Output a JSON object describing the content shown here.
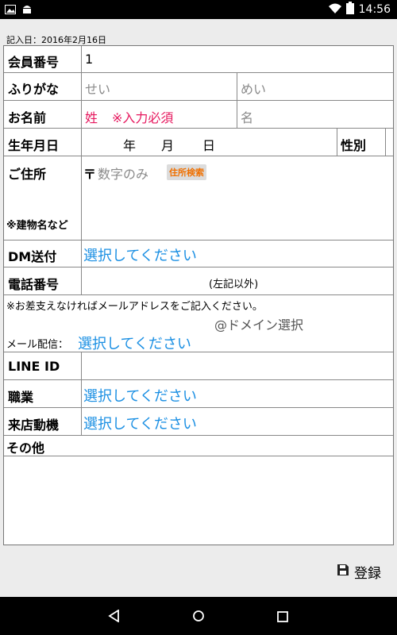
{
  "status_bar": {
    "time": "14:56",
    "battery_level": "4"
  },
  "header": {
    "date_label": "記入日：",
    "date_value": "2016年2月16日"
  },
  "rows": {
    "member": {
      "label": "会員番号",
      "value": "1"
    },
    "furigana": {
      "label": "ふりがな",
      "sei_placeholder": "せい",
      "mei_placeholder": "めい"
    },
    "name": {
      "label": "お名前",
      "sei": "姓",
      "required": "※入力必須",
      "mei_placeholder": "名"
    },
    "birth": {
      "label": "生年月日",
      "year": "年",
      "month": "月",
      "day": "日",
      "gender_label": "性別"
    },
    "address": {
      "label": "ご住所",
      "postal_mark": "〒",
      "postal_placeholder": "数字のみ",
      "search_button": "住所検索",
      "building_label": "※建物名など"
    },
    "dm": {
      "label": "DM送付",
      "value": "選択してください"
    },
    "phone": {
      "label": "電話番号",
      "note": "(左記以外)"
    },
    "email": {
      "note": "※お差支えなければメールアドレスをご記入ください。",
      "domain_placeholder": "@ドメイン選択",
      "delivery_label": "メール配信：",
      "delivery_value": "選択してください"
    },
    "line": {
      "label": "LINE ID"
    },
    "job": {
      "label": "職業",
      "value": "選択してください"
    },
    "visit": {
      "label": "来店動機",
      "value": "選択してください"
    },
    "other": {
      "label": "その他"
    }
  },
  "toolbar": {
    "save_label": "登録"
  },
  "colors": {
    "required": "#e6185e",
    "link": "#1a8fe3",
    "search_button_text": "#f07000"
  }
}
